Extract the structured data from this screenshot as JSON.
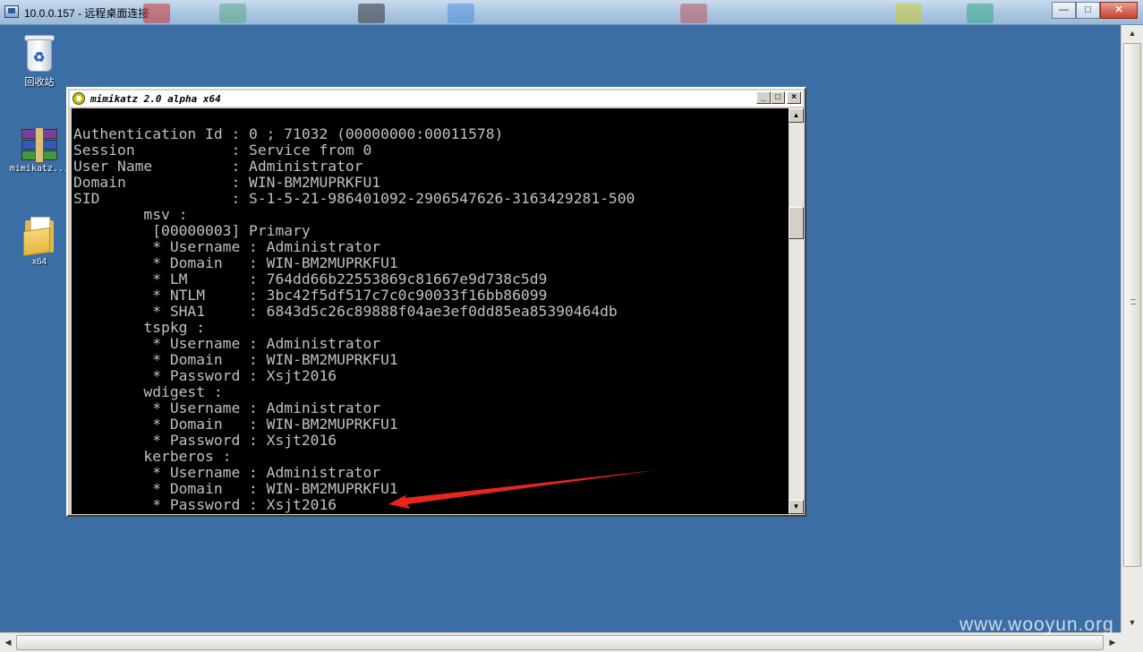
{
  "window": {
    "title": "10.0.0.157 - 远程桌面连接",
    "min_label": "—",
    "max_label": "□",
    "close_label": "✕"
  },
  "desktop": {
    "icons": [
      {
        "label": "回收站",
        "icon": "recycle-bin-icon"
      },
      {
        "label": "mimikatz...",
        "icon": "winrar-archive-icon"
      },
      {
        "label": "x64",
        "icon": "folder-icon"
      }
    ]
  },
  "console": {
    "title": "mimikatz 2.0 alpha x64",
    "lines": [
      "Authentication Id : 0 ; 71032 (00000000:00011578)",
      "Session           : Service from 0",
      "User Name         : Administrator",
      "Domain            : WIN-BM2MUPRKFU1",
      "SID               : S-1-5-21-986401092-2906547626-3163429281-500",
      "        msv :",
      "         [00000003] Primary",
      "         * Username : Administrator",
      "         * Domain   : WIN-BM2MUPRKFU1",
      "         * LM       : 764dd66b22553869c81667e9d738c5d9",
      "         * NTLM     : 3bc42f5df517c7c0c90033f16bb86099",
      "         * SHA1     : 6843d5c26c89888f04ae3ef0dd85ea85390464db",
      "        tspkg :",
      "         * Username : Administrator",
      "         * Domain   : WIN-BM2MUPRKFU1",
      "         * Password : Xsjt2016",
      "        wdigest :",
      "         * Username : Administrator",
      "         * Domain   : WIN-BM2MUPRKFU1",
      "         * Password : Xsjt2016",
      "        kerberos :",
      "         * Username : Administrator",
      "         * Domain   : WIN-BM2MUPRKFU1",
      "         * Password : Xsjt2016"
    ]
  },
  "watermark": "www.wooyun.org",
  "colors": {
    "desktop": "#3a6ea5",
    "console_bg": "#000000",
    "console_text": "#c0c0c0",
    "annotation_arrow": "#e8261d"
  }
}
